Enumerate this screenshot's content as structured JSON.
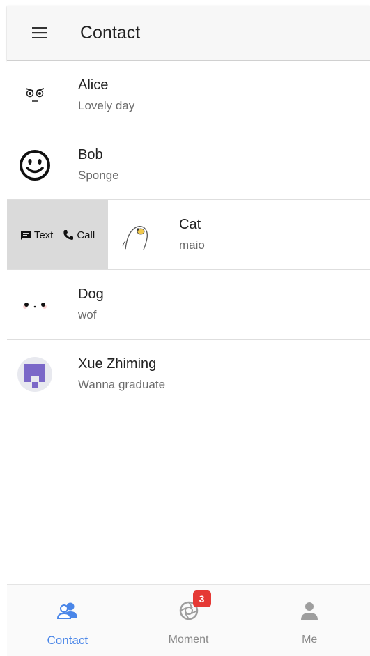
{
  "header": {
    "title": "Contact"
  },
  "contacts": [
    {
      "name": "Alice",
      "status": "Lovely day"
    },
    {
      "name": "Bob",
      "status": "Sponge"
    },
    {
      "name": "Cat",
      "status": "maio",
      "actions": {
        "text_label": "Text",
        "call_label": "Call"
      }
    },
    {
      "name": "Dog",
      "status": "wof"
    },
    {
      "name": "Xue Zhiming",
      "status": "Wanna graduate"
    }
  ],
  "tabs": [
    {
      "label": "Contact",
      "icon": "contacts-icon",
      "active": true
    },
    {
      "label": "Moment",
      "icon": "camera-aperture-icon",
      "badge": "3"
    },
    {
      "label": "Me",
      "icon": "person-icon"
    }
  ],
  "colors": {
    "accent": "#4a86e8",
    "badge": "#e53935",
    "swipe_bg": "#dadada"
  }
}
